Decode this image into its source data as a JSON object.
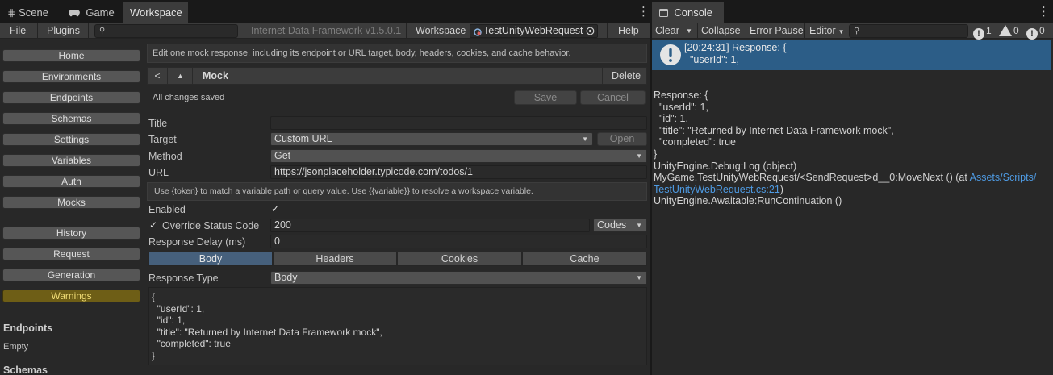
{
  "tabs": {
    "scene": "Scene",
    "game": "Game",
    "workspace": "Workspace",
    "console": "Console",
    "scene_icon": "grid-icon",
    "game_icon": "gamepad-icon",
    "console_icon": "console-icon"
  },
  "toolbar": {
    "file": "File",
    "plugins": "Plugins",
    "product": "Internet Data Framework v1.5.0.1",
    "workspace_label": "Workspace",
    "workspace_value": "TestUnityWebRequest",
    "help": "Help"
  },
  "sidebar": {
    "nav": [
      "Home",
      "Environments",
      "Endpoints",
      "Schemas",
      "Settings",
      "Variables",
      "Auth",
      "Mocks"
    ],
    "tools": [
      "History",
      "Request",
      "Generation",
      "Warnings"
    ],
    "endpoints_heading": "Endpoints",
    "endpoints_empty": "Empty",
    "schemas_heading": "Schemas"
  },
  "editor": {
    "description": "Edit one mock response, including its endpoint or URL target, body, headers, cookies, and cache behavior.",
    "back": "<",
    "up": "▲",
    "title": "Mock",
    "delete": "Delete",
    "status": "All changes saved",
    "save": "Save",
    "cancel": "Cancel",
    "fields": {
      "title_label": "Title",
      "title_value": "",
      "target_label": "Target",
      "target_value": "Custom URL",
      "open": "Open",
      "method_label": "Method",
      "method_value": "Get",
      "url_label": "URL",
      "url_value": "https://jsonplaceholder.typicode.com/todos/1",
      "url_hint": "Use {token} to match a variable path or query value. Use {{variable}} to resolve a workspace variable.",
      "enabled_label": "Enabled",
      "enabled_checked": true,
      "override_label": "Override Status Code",
      "override_checked": true,
      "status_code": "200",
      "codes": "Codes",
      "delay_label": "Response Delay (ms)",
      "delay_value": "0"
    },
    "sections": [
      "Body",
      "Headers",
      "Cookies",
      "Cache"
    ],
    "active_section": "Body",
    "response_type_label": "Response Type",
    "response_type_value": "Body",
    "body_text": "{\n  \"userId\": 1,\n  \"id\": 1,\n  \"title\": \"Returned by Internet Data Framework mock\",\n  \"completed\": true\n}"
  },
  "console": {
    "clear": "Clear",
    "collapse": "Collapse",
    "error_pause": "Error Pause",
    "editor": "Editor",
    "info_count": "1",
    "warn_count": "0",
    "error_count": "0",
    "entry": {
      "text": "[20:24:31] Response: {\n  \"userId\": 1,",
      "icon": "info-icon"
    },
    "detail": {
      "body": "Response: {\n  \"userId\": 1,\n  \"id\": 1,\n  \"title\": \"Returned by Internet Data Framework mock\",\n  \"completed\": true\n}\nUnityEngine.Debug:Log (object)\nMyGame.TestUnityWebRequest/<SendRequest>d__0:MoveNext () (at ",
      "link": "Assets/Scripts/\nTestUnityWebRequest.cs:21",
      "after_link": ")\nUnityEngine.Awaitable:RunContinuation ()"
    },
    "colors": {
      "selected_row": "#2c5d87",
      "link": "#4e9ae2"
    }
  },
  "colors": {
    "active_segment": "#46607c",
    "warning_button": "#6e5e16"
  }
}
